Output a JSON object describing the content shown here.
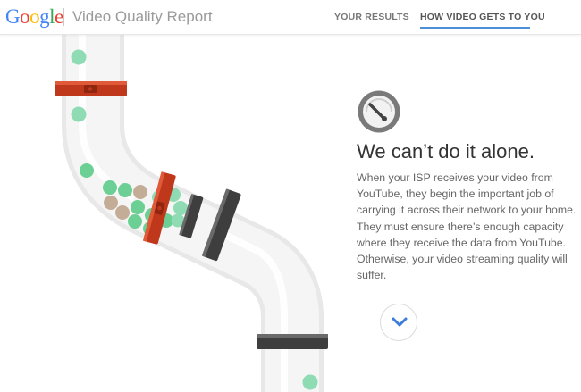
{
  "header": {
    "logo_text": "Google",
    "app_title": "Video Quality Report",
    "nav": [
      {
        "label": "YOUR RESULTS",
        "active": false
      },
      {
        "label": "HOW VIDEO GETS TO YOU",
        "active": true
      }
    ],
    "active_underline_color": "#4a90d9"
  },
  "main": {
    "icon": "speedometer-icon",
    "headline": "We can’t do it alone.",
    "body": "When your ISP receives your video from YouTube, they begin the important job of carrying it across their network to your home. They must ensure there’s enough capacity where they receive the data from YouTube. Otherwise, your video streaming quality will suffer.",
    "scroll_button_icon": "chevron-down-icon"
  },
  "colors": {
    "pipe": "#f4f4f4",
    "pipe_edge": "#e6e6e6",
    "red_band": "#c0381c",
    "dark_band": "#444444",
    "green_dot": "#8fdcb4",
    "green_dot_dark": "#6ccf93",
    "tan_dot": "#c4ad97",
    "accent": "#3b7dd8"
  }
}
